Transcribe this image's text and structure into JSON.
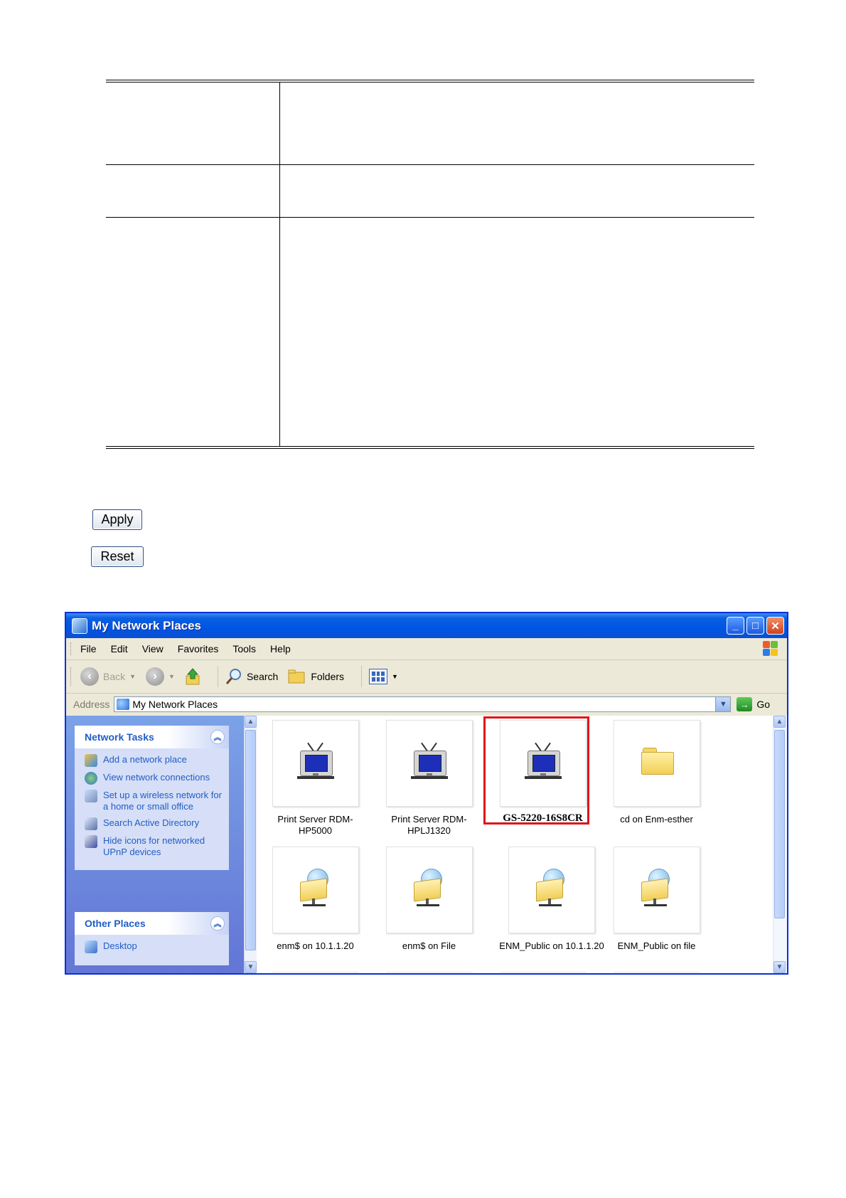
{
  "buttons": {
    "apply": "Apply",
    "reset": "Reset"
  },
  "window": {
    "title": "My Network Places",
    "caption": {
      "minimize": "_",
      "maximize": "□",
      "close": "✕"
    },
    "menu": [
      {
        "label": "File"
      },
      {
        "label": "Edit"
      },
      {
        "label": "View"
      },
      {
        "label": "Favorites"
      },
      {
        "label": "Tools"
      },
      {
        "label": "Help"
      }
    ],
    "toolbar": {
      "back": "Back",
      "search": "Search",
      "folders": "Folders"
    },
    "address": {
      "label": "Address",
      "value": "My Network Places",
      "go": "Go"
    },
    "network_tasks": {
      "title": "Network Tasks",
      "items": [
        "Add a network place",
        "View network connections",
        "Set up a wireless network for a home or small office",
        "Search Active Directory",
        "Hide icons for networked UPnP devices"
      ]
    },
    "other_places": {
      "title": "Other Places",
      "items": [
        "Desktop"
      ]
    },
    "icons": [
      "Print Server RDM-HP5000",
      "Print Server RDM-HPLJ1320",
      "GS-5220-16S8CR",
      "cd on Enm-esther",
      "enm$ on 10.1.1.20",
      "enm$ on File",
      "ENM_Public on 10.1.1.20",
      "ENM_Public on file"
    ],
    "highlight_color": "#e0141a"
  },
  "colors": {
    "titlebar": "#0055e5",
    "task_link": "#215dc6",
    "pane": "#6375d6"
  }
}
